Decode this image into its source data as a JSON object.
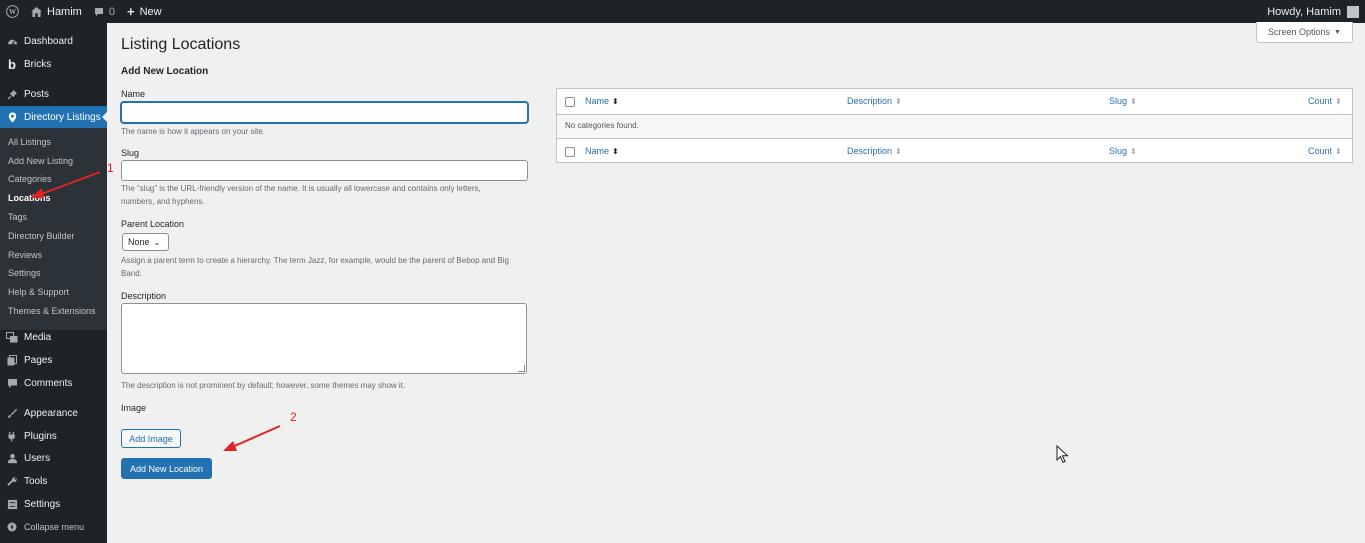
{
  "adminbar": {
    "site_name": "Hamim",
    "comments_count": "0",
    "new_label": "New",
    "howdy": "Howdy, Hamim"
  },
  "sidebar": {
    "items": [
      {
        "label": "Dashboard",
        "icon": "dashboard-icon"
      },
      {
        "label": "Bricks",
        "icon": "bricks-icon"
      },
      {
        "label": "Posts",
        "icon": "pin-icon"
      },
      {
        "label": "Directory Listings",
        "icon": "directory-icon"
      },
      {
        "label": "Media",
        "icon": "media-icon"
      },
      {
        "label": "Pages",
        "icon": "pages-icon"
      },
      {
        "label": "Comments",
        "icon": "comments-icon"
      },
      {
        "label": "Appearance",
        "icon": "appearance-icon"
      },
      {
        "label": "Plugins",
        "icon": "plugins-icon"
      },
      {
        "label": "Users",
        "icon": "users-icon"
      },
      {
        "label": "Tools",
        "icon": "tools-icon"
      },
      {
        "label": "Settings",
        "icon": "settings-icon"
      },
      {
        "label": "Collapse menu",
        "icon": "collapse-icon"
      }
    ],
    "submenu": [
      "All Listings",
      "Add New Listing",
      "Categories",
      "Locations",
      "Tags",
      "Directory Builder",
      "Reviews",
      "Settings",
      "Help & Support",
      "Themes & Extensions"
    ]
  },
  "main": {
    "title": "Listing Locations",
    "screen_options": "Screen Options",
    "form": {
      "heading": "Add New Location",
      "name_label": "Name",
      "name_value": "",
      "name_help": "The name is how it appears on your site.",
      "slug_label": "Slug",
      "slug_value": "",
      "slug_help": "The “slug” is the URL-friendly version of the name. It is usually all lowercase and contains only letters, numbers, and hyphens.",
      "parent_label": "Parent Location",
      "parent_value": "None",
      "parent_help": "Assign a parent term to create a hierarchy. The term Jazz, for example, would be the parent of Bebop and Big Band.",
      "description_label": "Description",
      "description_help": "The description is not prominent by default; however, some themes may show it.",
      "image_label": "Image",
      "add_image": "Add Image",
      "submit": "Add New Location"
    },
    "table": {
      "columns": [
        "Name",
        "Description",
        "Slug",
        "Count"
      ],
      "empty": "No categories found."
    }
  },
  "annotations": {
    "marker_1": "1",
    "marker_2": "2",
    "color": "#e02424"
  },
  "colors": {
    "accent": "#2271b1",
    "admin_bg": "#1d2327",
    "submenu_bg": "#2c3338"
  }
}
